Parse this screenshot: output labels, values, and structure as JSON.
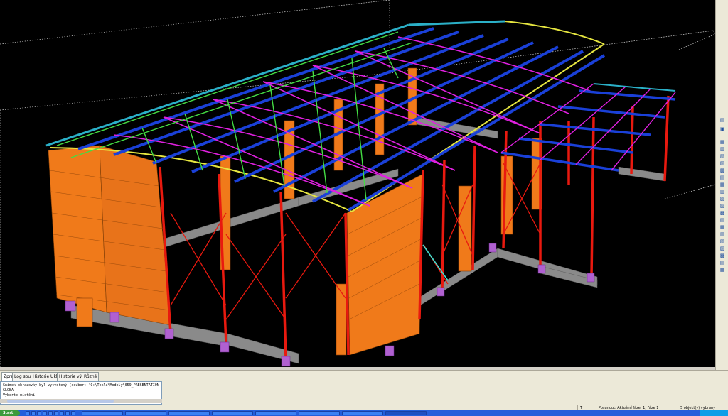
{
  "tabs": [
    {
      "label": "Zprávy",
      "active": true
    },
    {
      "label": "Log soubor",
      "active": false
    },
    {
      "label": "Historie Ukládání",
      "active": false
    },
    {
      "label": "Historie výkresů",
      "active": false
    },
    {
      "label": "Různé",
      "active": false
    }
  ],
  "log": {
    "lines": [
      "Snímek obrazovky byl vytvořený (soubor: 'C:\\Tekla\\Modely\\059_PRESENTATION GLOBA",
      "Vyberte místění"
    ]
  },
  "status": {
    "cell1": "T",
    "cell2": "Posunout: Aktuální fáze: 1, Fáze 1",
    "cell3": "5 objekt(y) vybrány"
  },
  "taskbar": {
    "start_label": "Start"
  },
  "colors": {
    "columns": "#e8190f",
    "purlins": "#1a40d8",
    "bracing": "#e020e0",
    "green_members": "#44dd44",
    "cladding": "#f07a1a",
    "foundations": "#8a8a8a",
    "viewport_bg": "#000000"
  },
  "icons": {
    "toolbar": [
      "align-icon",
      "snap-icon",
      "grid-icon",
      "point-icon",
      "line-icon",
      "plane-icon"
    ]
  }
}
